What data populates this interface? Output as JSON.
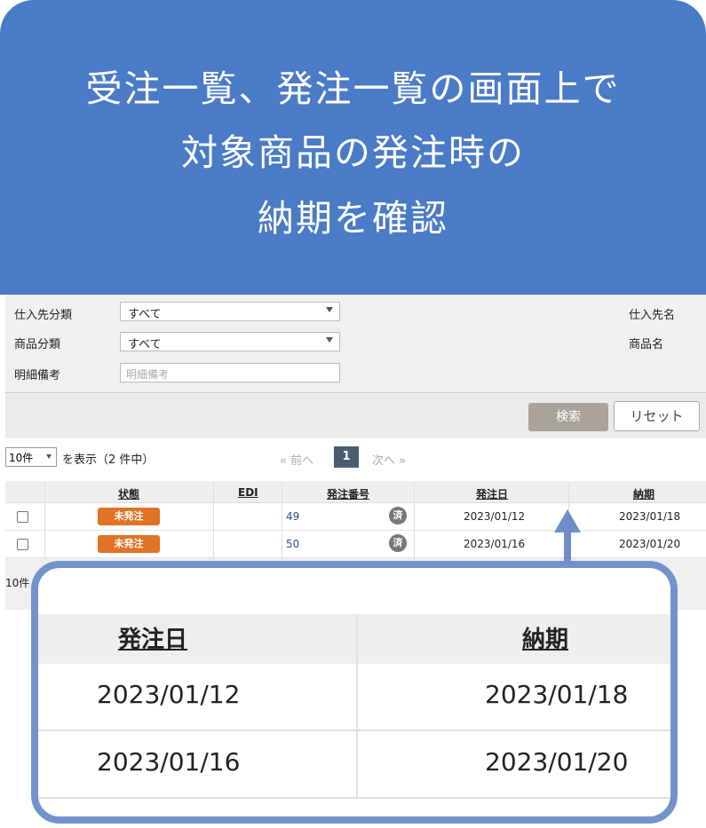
{
  "banner": {
    "line1": "受注一覧、発注一覧の画面上で",
    "line2": "対象商品の発注時の",
    "line3": "納期を確認"
  },
  "filters": {
    "supplier_category_label": "仕入先分類",
    "supplier_category_value": "すべて",
    "product_category_label": "商品分類",
    "product_category_value": "すべて",
    "detail_note_label": "明細備考",
    "detail_note_placeholder": "明細備考",
    "supplier_name_label": "仕入先名",
    "product_name_label": "商品名"
  },
  "buttons": {
    "search": "検索",
    "reset": "リセット"
  },
  "pager": {
    "per_page": "10件",
    "show_text": "を表示（2 件中）",
    "prev": "« 前へ",
    "current_page": "1",
    "next": "次へ »"
  },
  "table": {
    "headers": {
      "status": "状態",
      "edi": "EDI",
      "order_no": "発注番号",
      "order_date": "発注日",
      "delivery_date": "納期"
    },
    "rows": [
      {
        "status": "未発注",
        "order_no": "49",
        "done": "済",
        "order_date": "2023/01/12",
        "delivery_date": "2023/01/18"
      },
      {
        "status": "未発注",
        "order_no": "50",
        "done": "済",
        "order_date": "2023/01/16",
        "delivery_date": "2023/01/20"
      }
    ]
  },
  "footer": {
    "per_page": "10件"
  },
  "colors": {
    "banner": "#4a7bc6",
    "status_badge": "#e07326",
    "zoom_border": "#7392cc"
  }
}
